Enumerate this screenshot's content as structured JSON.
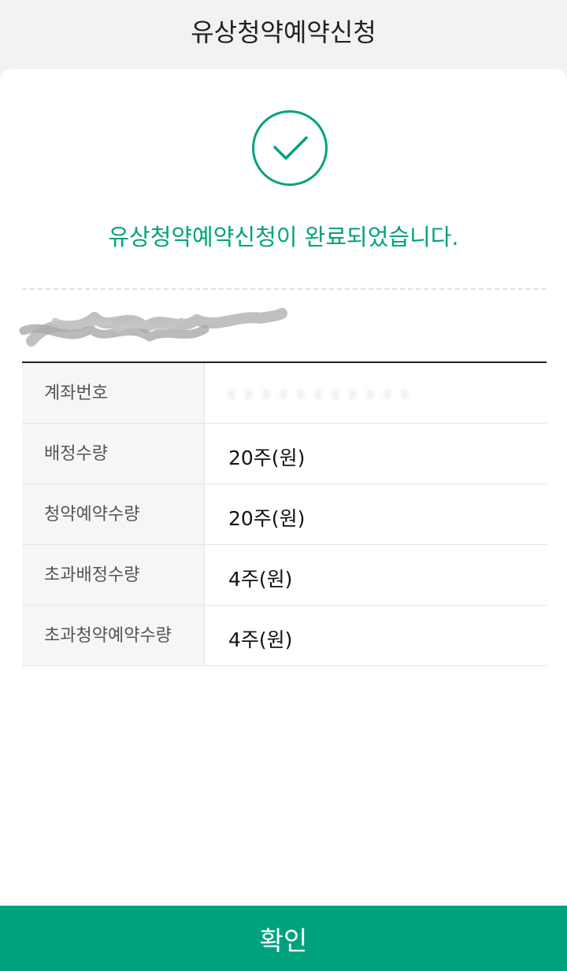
{
  "header": {
    "title": "유상청약예약신청"
  },
  "result": {
    "icon": "check-circle-icon",
    "message": "유상청약예약신청이 완료되었습니다.",
    "accent_color": "#00a27e"
  },
  "details": {
    "rows": [
      {
        "label": "계좌번호",
        "value": ""
      },
      {
        "label": "배정수량",
        "value": "20주(원)"
      },
      {
        "label": "청약예약수량",
        "value": "20주(원)"
      },
      {
        "label": "초과배정수량",
        "value": "4주(원)"
      },
      {
        "label": "초과청약예약수량",
        "value": "4주(원)"
      }
    ]
  },
  "footer": {
    "confirm_label": "확인",
    "button_color": "#00a27e"
  }
}
